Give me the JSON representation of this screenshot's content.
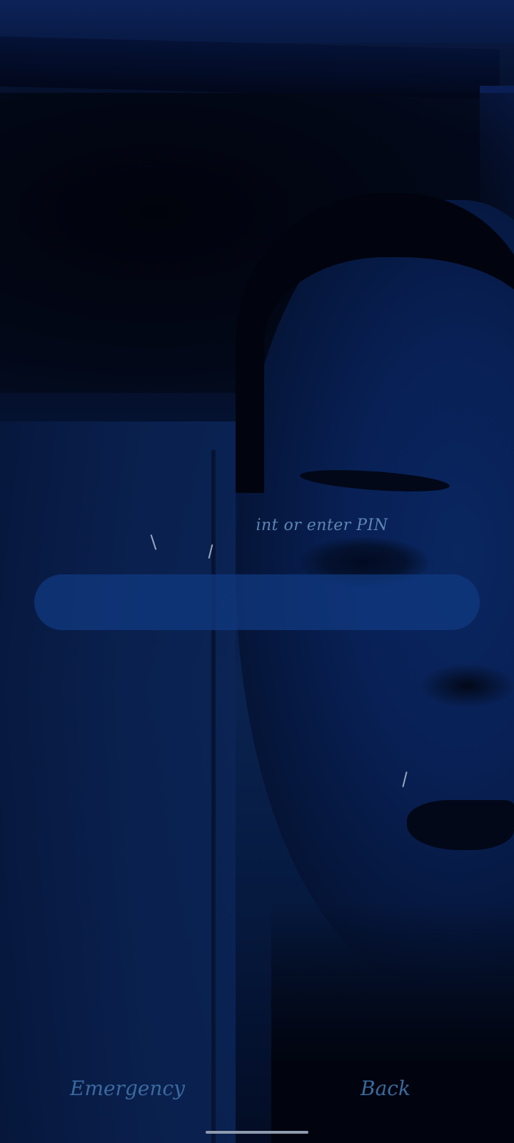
{
  "lockscreen": {
    "prompt": "int or enter PIN",
    "pin_value": "",
    "pin_placeholder": ""
  },
  "actions": {
    "emergency_label": "Emergency",
    "back_label": "Back"
  },
  "colors": {
    "prompt_text": "#5f86b5",
    "pin_field": "#103a82",
    "action_text": "#3a6aa0",
    "nav_handle": "#8e9aae"
  }
}
